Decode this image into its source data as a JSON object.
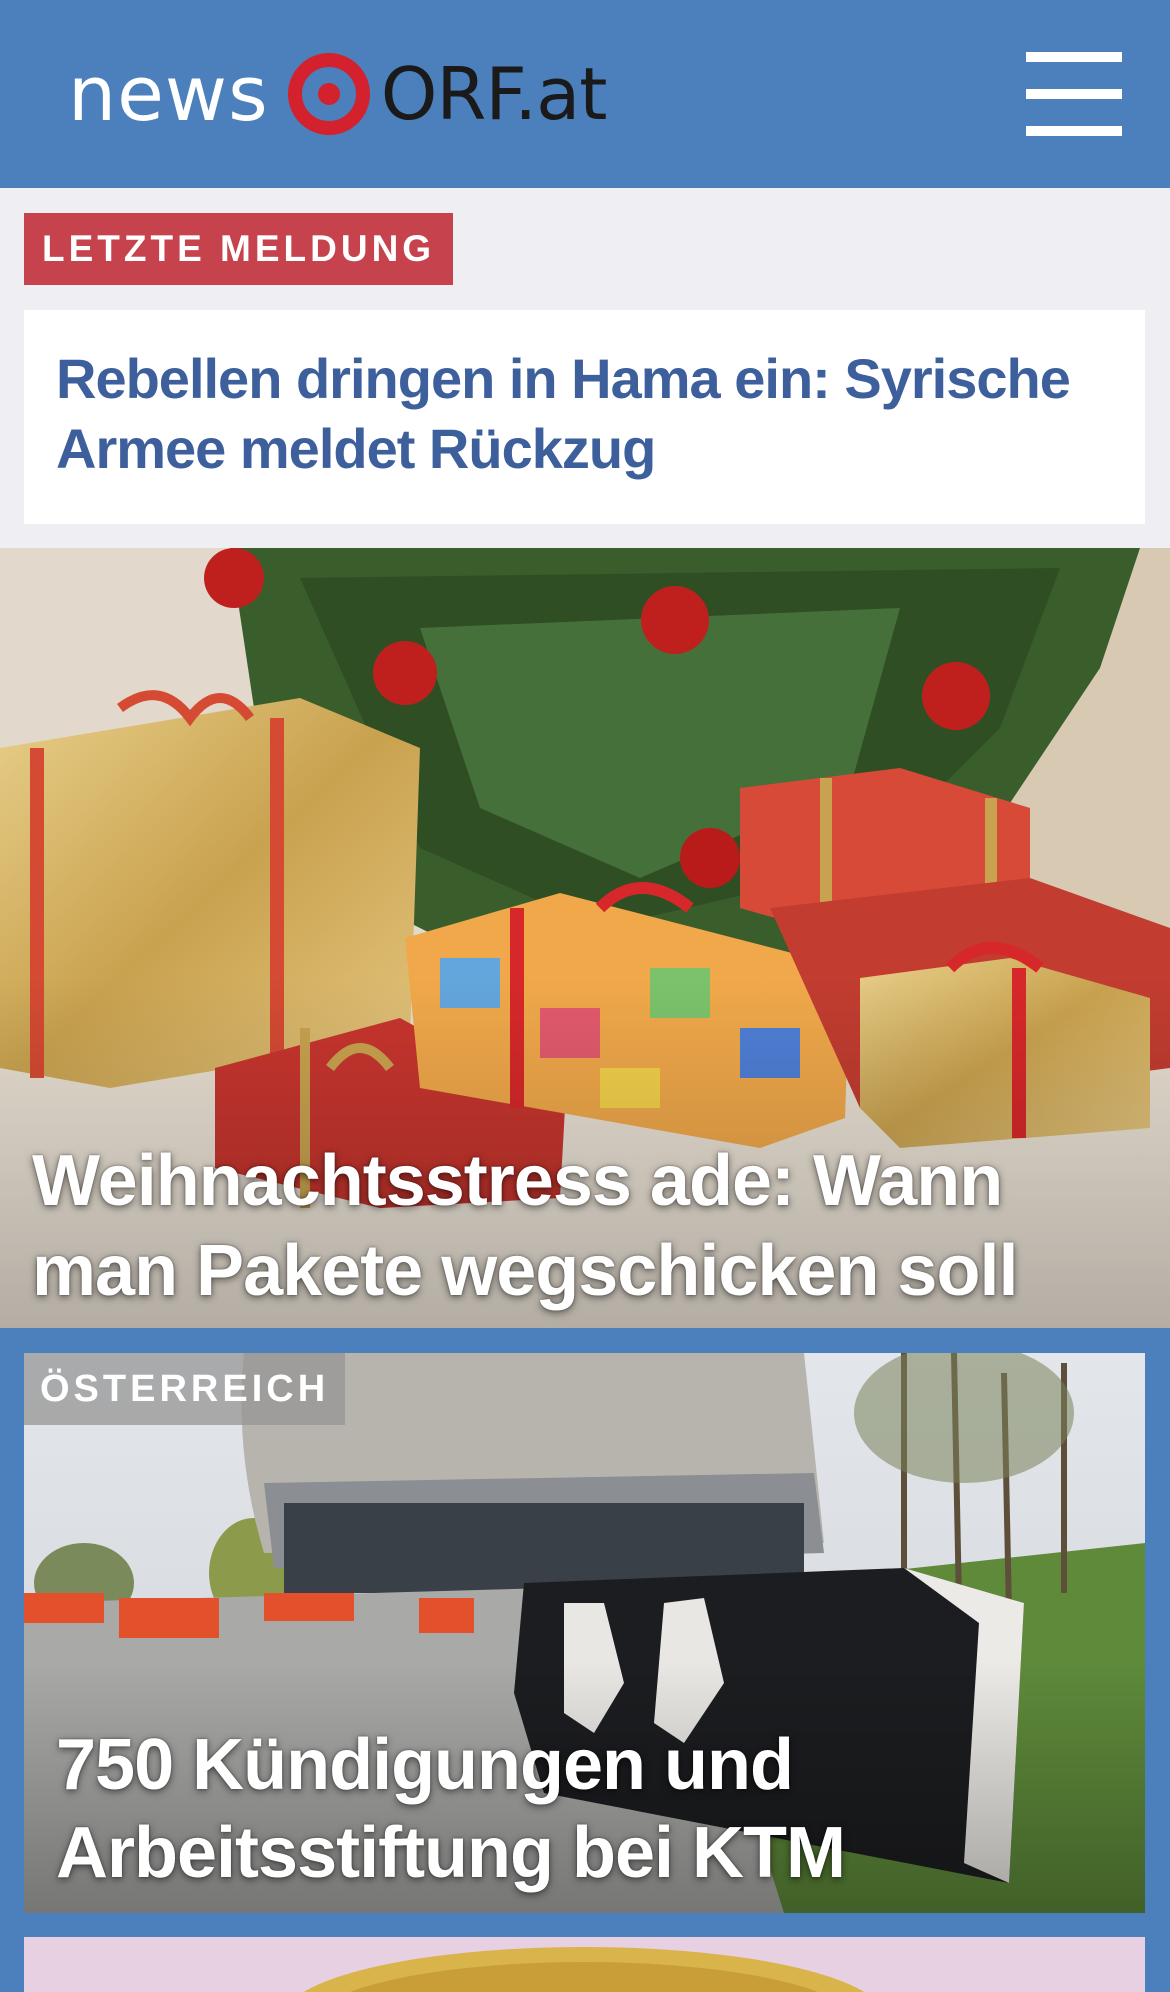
{
  "header": {
    "logo_news": "news",
    "logo_orf": "ORF.at",
    "menu_icon": "hamburger-menu-icon"
  },
  "breaking": {
    "badge": "LETZTE MELDUNG",
    "title": "Rebellen dringen in Hama ein: Syrische Armee meldet Rückzug"
  },
  "stories": [
    {
      "title": "Weihnachtsstress ade: Wann man Pakete wegschicken soll",
      "image": "christmas-tree-with-presents"
    },
    {
      "section": "ÖSTERREICH",
      "title": "750 Kündigungen und Arbeitsstiftung bei KTM",
      "image": "ktm-headquarters-building"
    },
    {
      "image": "gold-coin-partial"
    }
  ],
  "colors": {
    "brand_blue": "#4b80bc",
    "breaking_red": "#c6434d",
    "headline_blue": "#3d5f9c",
    "logo_red": "#d3212d"
  }
}
